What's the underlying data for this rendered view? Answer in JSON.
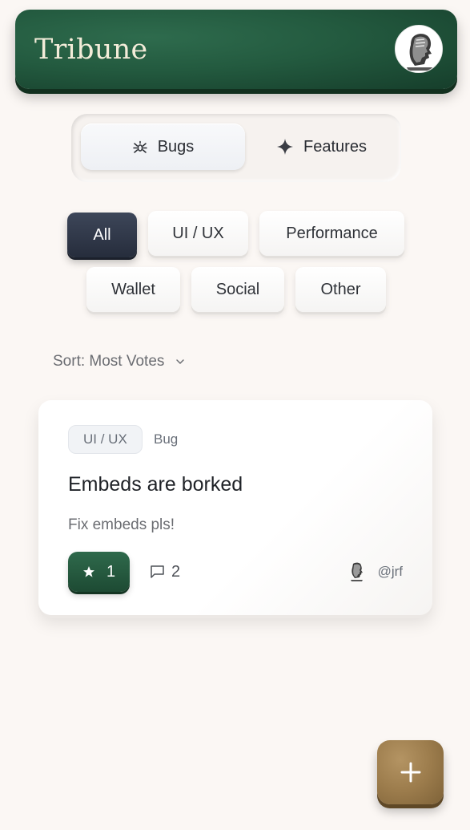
{
  "header": {
    "brand": "Tribune",
    "avatar_icon": "bust-avatar-icon"
  },
  "segment": {
    "active": "Bugs",
    "tabs": [
      {
        "label": "Bugs",
        "icon": "bug-icon"
      },
      {
        "label": "Features",
        "icon": "sparkle-icon"
      }
    ]
  },
  "filters": {
    "selected": "All",
    "items": [
      "All",
      "UI / UX",
      "Performance",
      "Wallet",
      "Social",
      "Other"
    ]
  },
  "sort": {
    "label": "Sort: Most Votes",
    "icon": "chevron-down-icon"
  },
  "posts": [
    {
      "tag": "UI / UX",
      "type": "Bug",
      "title": "Embeds are borked",
      "description": "Fix embeds pls!",
      "votes": "1",
      "comments": "2",
      "author": "@jrf"
    }
  ],
  "fab": {
    "icon": "plus-icon"
  },
  "colors": {
    "background": "#fbf7f4",
    "header_green": "#235a3f",
    "active_chip": "#2f3648",
    "vote_green": "#245a3f",
    "fab_gold": "#9c7c4c"
  }
}
